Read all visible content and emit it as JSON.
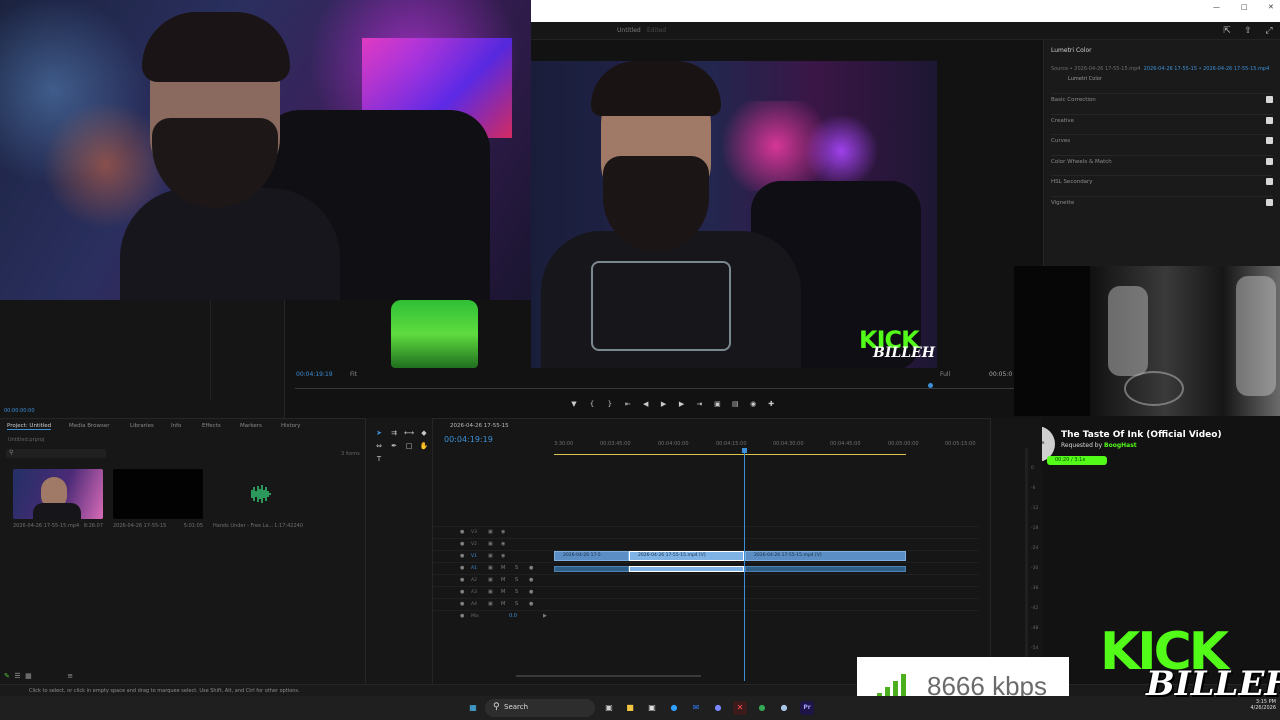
{
  "window": {
    "doc_title": "Untitled",
    "doc_status": "Edited"
  },
  "source_monitor": {
    "timecode": "00:00:00:00"
  },
  "program_monitor": {
    "timecode": "00:04:19:19",
    "fit": "Fit",
    "quality": "Full",
    "duration": "00:05:0"
  },
  "lumetri": {
    "title": "Lumetri Color",
    "source_label": "Source • 2026-04-26 17-55-15.mp4",
    "source_link": "2026-04-26 17-55-15 • 2026-04-26 17-55-15.mp4",
    "sub": "Lumetri Color",
    "sections": [
      "Basic Correction",
      "Creative",
      "Curves",
      "Color Wheels & Match",
      "HSL Secondary",
      "Vignette"
    ]
  },
  "overlay_video": {
    "kick": "KICK",
    "billeh": "BILLEH"
  },
  "music": {
    "song": "The Taste Of Ink (Official Video)",
    "requested_prefix": "Requested by ",
    "requester": "BoogHast",
    "progress": "00:20 / 3:1x"
  },
  "project": {
    "tabs": [
      "Project: Untitled",
      "Media Browser",
      "Libraries",
      "Info",
      "Effects",
      "Markers",
      "History"
    ],
    "path": "Untitled.prproj",
    "items_count": "3 items",
    "items": [
      {
        "name": "2026-04-26 17-55-15.mp4",
        "duration": "8:26:07",
        "kind": "video"
      },
      {
        "name": "2026-04-26 17-55-15",
        "duration": "5:01:05",
        "kind": "sequence"
      },
      {
        "name": "Hands Under - Free La...",
        "duration": "1:17:42240",
        "kind": "audio"
      }
    ]
  },
  "timeline": {
    "sequence": "2026-04-26 17-55-15",
    "timecode": "00:04:19:19",
    "ruler": [
      "3:30:00",
      "00:03:45:00",
      "00:04:00:00",
      "00:04:15:00",
      "00:04:30:00",
      "00:04:45:00",
      "00:05:00:00",
      "00:05:15:00"
    ],
    "tracks": [
      {
        "name": "V3",
        "type": "video"
      },
      {
        "name": "V2",
        "type": "video"
      },
      {
        "name": "V1",
        "type": "video"
      },
      {
        "name": "A1",
        "type": "audio"
      },
      {
        "name": "A2",
        "type": "audio"
      },
      {
        "name": "A3",
        "type": "audio"
      },
      {
        "name": "A4",
        "type": "audio"
      },
      {
        "name": "Mix",
        "type": "mix"
      }
    ],
    "clips": [
      {
        "label": "2026-04-26 17-5",
        "track": "V1"
      },
      {
        "label": "2026-04-26 17-55-15.mp4 [V]",
        "track": "V1",
        "selected": true
      },
      {
        "label": "2026-04-26 17-55-15.mp4 [V]",
        "track": "V1"
      }
    ],
    "mix_value": "0.0"
  },
  "meters": {
    "scale": [
      "0",
      "-6",
      "-12",
      "-18",
      "-24",
      "-30",
      "-36",
      "-42",
      "-48",
      "-54",
      "dB"
    ]
  },
  "bitrate": {
    "value": "8666 kbps"
  },
  "status": {
    "message": "Click to select, or click in empty space and drag to marquee select. Use Shift, Alt, and Ctrl for other options."
  },
  "taskbar": {
    "search": "Search",
    "time": "3:15 PM",
    "date": "4/26/2026"
  },
  "colors": {
    "kick_green": "#53fc18",
    "premiere_blue": "#3c8fd6",
    "clip_blue": "#5b8ec4"
  }
}
